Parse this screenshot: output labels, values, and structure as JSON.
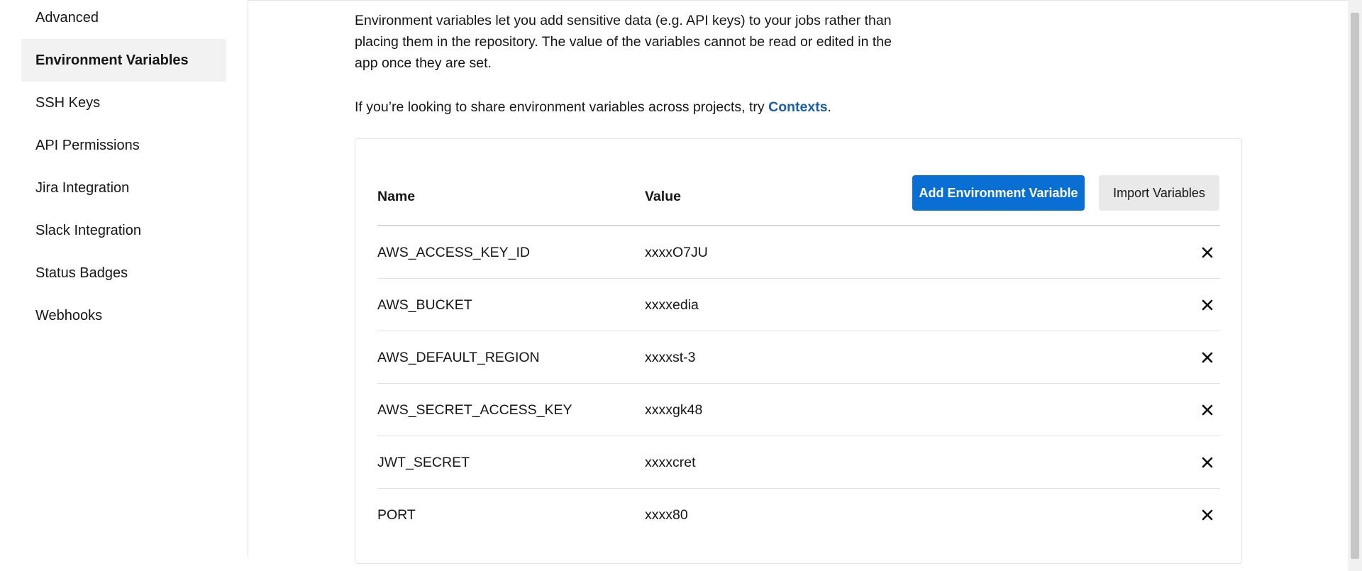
{
  "sidebar": {
    "items": [
      {
        "label": "Advanced",
        "active": false
      },
      {
        "label": "Environment Variables",
        "active": true
      },
      {
        "label": "SSH Keys",
        "active": false
      },
      {
        "label": "API Permissions",
        "active": false
      },
      {
        "label": "Jira Integration",
        "active": false
      },
      {
        "label": "Slack Integration",
        "active": false
      },
      {
        "label": "Status Badges",
        "active": false
      },
      {
        "label": "Webhooks",
        "active": false
      }
    ]
  },
  "main": {
    "intro_line1": "Environment variables let you add sensitive data (e.g. API keys) to your jobs rather than",
    "intro_line2": "placing them in the repository. The value of the variables cannot be read or edited in the",
    "intro_line3": "app once they are set.",
    "share_prefix": "If you’re looking to share environment variables across projects, try ",
    "share_link": "Contexts",
    "share_suffix": "."
  },
  "table": {
    "name_header": "Name",
    "value_header": "Value",
    "add_button": "Add Environment Variable",
    "import_button": "Import Variables",
    "rows": [
      {
        "name": "AWS_ACCESS_KEY_ID",
        "value": "xxxxO7JU"
      },
      {
        "name": "AWS_BUCKET",
        "value": "xxxxedia"
      },
      {
        "name": "AWS_DEFAULT_REGION",
        "value": "xxxxst-3"
      },
      {
        "name": "AWS_SECRET_ACCESS_KEY",
        "value": "xxxxgk48"
      },
      {
        "name": "JWT_SECRET",
        "value": "xxxxcret"
      },
      {
        "name": "PORT",
        "value": "xxxx80"
      }
    ]
  },
  "icons": {
    "delete": "close-icon"
  },
  "colors": {
    "primary": "#0a6fd3",
    "link": "#1b5fa8",
    "active_nav_bg": "#f2f2f2"
  }
}
